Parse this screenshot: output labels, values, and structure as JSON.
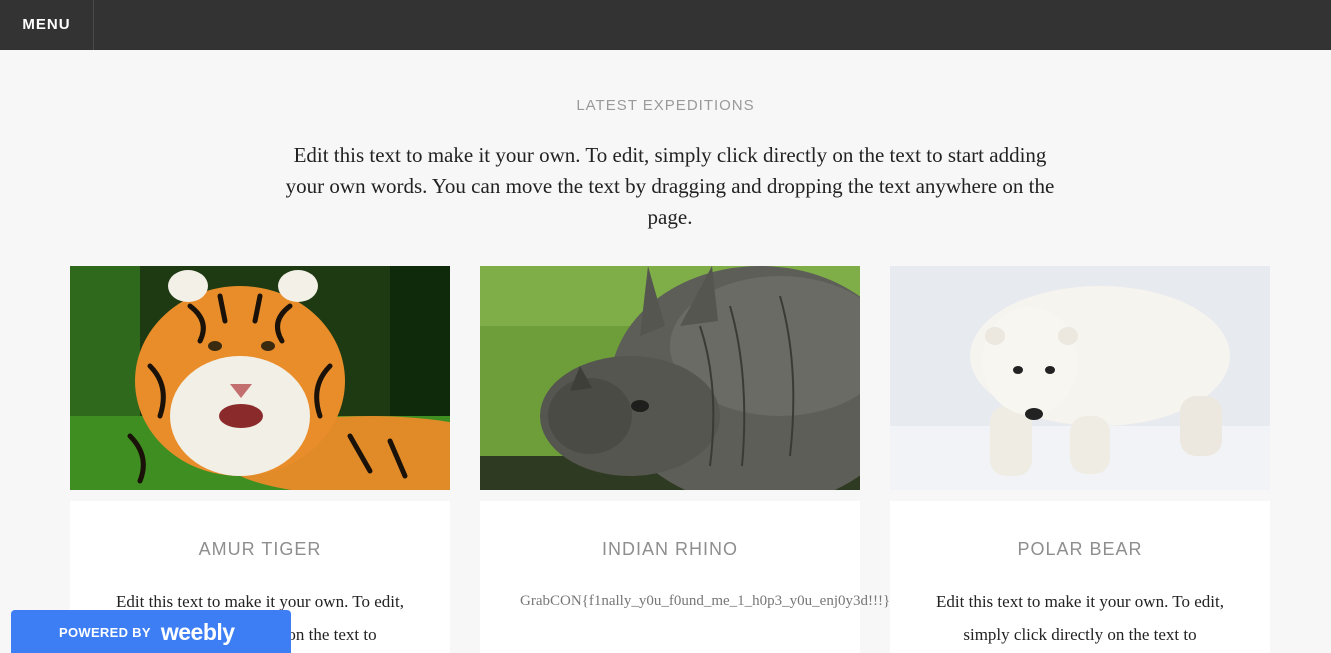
{
  "nav": {
    "menu_label": "MENU"
  },
  "section": {
    "label": "LATEST EXPEDITIONS",
    "intro": "Edit this text to make it your own. To edit, simply click directly on the text to start adding your own words. You can move the text by dragging and dropping the text anywhere on the page."
  },
  "cards": [
    {
      "title": "AMUR TIGER",
      "text": "Edit this text to make it your own. To edit, simply click directly on the text to"
    },
    {
      "title": "INDIAN RHINO",
      "text": "GrabCON{f1nally_y0u_f0und_me_1_h0p3_y0u_enj0y3d!!!}"
    },
    {
      "title": "POLAR BEAR",
      "text": "Edit this text to make it your own. To edit, simply click directly on the text to"
    }
  ],
  "badge": {
    "powered_by": "POWERED BY",
    "brand": "weebly"
  },
  "colors": {
    "topbar": "#333333",
    "page_bg": "#f7f7f7",
    "badge_bg": "#3d7ef5",
    "muted_heading": "#9a9a9a"
  }
}
